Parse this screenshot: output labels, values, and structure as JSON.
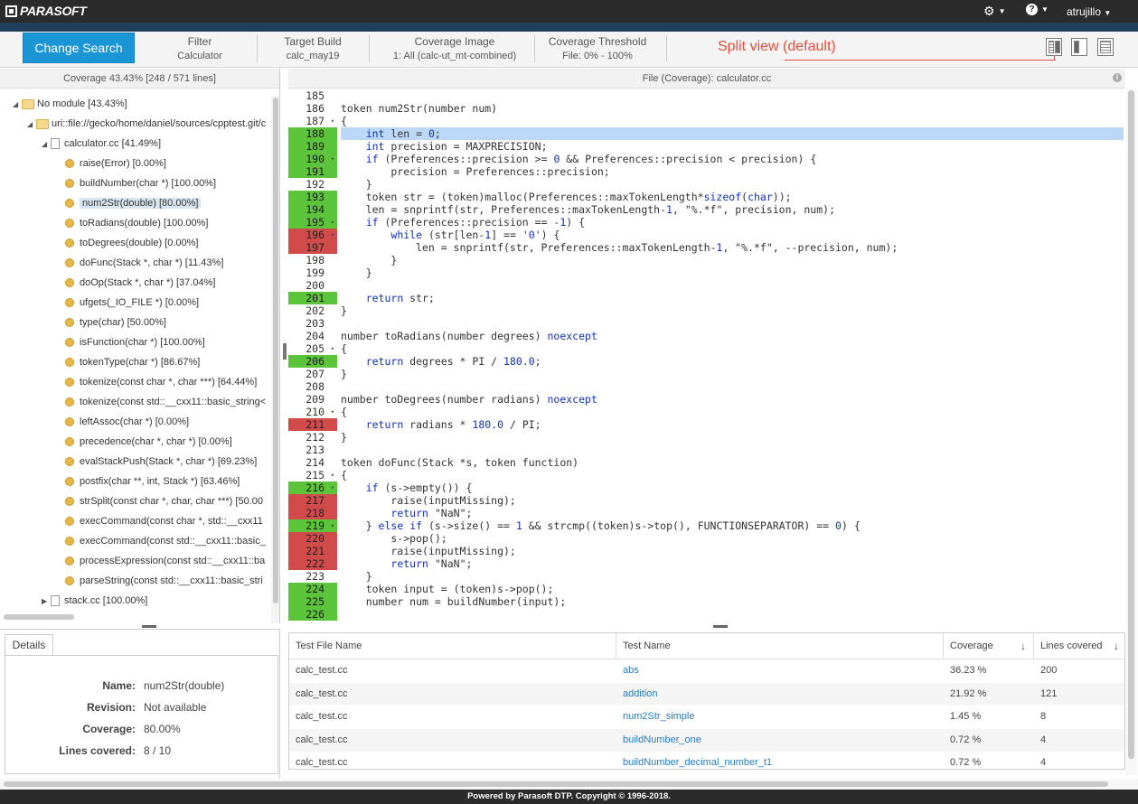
{
  "brand": "PARASOFT",
  "user": "atrujillo",
  "toolbar": {
    "change_search": "Change Search",
    "groups": [
      {
        "label": "Filter",
        "value": "Calculator"
      },
      {
        "label": "Target Build",
        "value": "calc_may19"
      },
      {
        "label": "Coverage Image",
        "value": "1: All (calc-ut_mt-combined)"
      },
      {
        "label": "Coverage Threshold",
        "value": "File: 0% - 100%"
      }
    ],
    "split_note": "Split view (default)"
  },
  "left_header": "Coverage 43.43% [248 / 571 lines]",
  "tree": [
    {
      "label": "No module [43.43%]",
      "kind": "folder",
      "depth": 0,
      "expanded": true
    },
    {
      "label": "uri::file://gecko/home/daniel/sources/cpptest.git/c",
      "kind": "folder",
      "depth": 1,
      "expanded": true
    },
    {
      "label": "calculator.cc [41.49%]",
      "kind": "file",
      "depth": 2,
      "expanded": true
    },
    {
      "label": "raise(Error) [0.00%]",
      "kind": "func",
      "depth": 3
    },
    {
      "label": "buildNumber(char *) [100.00%]",
      "kind": "func",
      "depth": 3
    },
    {
      "label": "num2Str(double) [80.00%]",
      "kind": "func",
      "depth": 3,
      "selected": true
    },
    {
      "label": "toRadians(double) [100.00%]",
      "kind": "func",
      "depth": 3
    },
    {
      "label": "toDegrees(double) [0.00%]",
      "kind": "func",
      "depth": 3
    },
    {
      "label": "doFunc(Stack *, char *) [11.43%]",
      "kind": "func",
      "depth": 3
    },
    {
      "label": "doOp(Stack *, char *) [37.04%]",
      "kind": "func",
      "depth": 3
    },
    {
      "label": "ufgets(_IO_FILE *) [0.00%]",
      "kind": "func",
      "depth": 3
    },
    {
      "label": "type(char) [50.00%]",
      "kind": "func",
      "depth": 3
    },
    {
      "label": "isFunction(char *) [100.00%]",
      "kind": "func",
      "depth": 3
    },
    {
      "label": "tokenType(char *) [86.67%]",
      "kind": "func",
      "depth": 3
    },
    {
      "label": "tokenize(const char *, char ***) [64.44%]",
      "kind": "func",
      "depth": 3
    },
    {
      "label": "tokenize(const std::__cxx11::basic_string<",
      "kind": "func",
      "depth": 3
    },
    {
      "label": "leftAssoc(char *) [0.00%]",
      "kind": "func",
      "depth": 3
    },
    {
      "label": "precedence(char *, char *) [0.00%]",
      "kind": "func",
      "depth": 3
    },
    {
      "label": "evalStackPush(Stack *, char *) [69.23%]",
      "kind": "func",
      "depth": 3
    },
    {
      "label": "postfix(char **, int, Stack *) [63.46%]",
      "kind": "func",
      "depth": 3
    },
    {
      "label": "strSplit(const char *, char, char ***) [50.00",
      "kind": "func",
      "depth": 3
    },
    {
      "label": "execCommand(const char *, std::__cxx11",
      "kind": "func",
      "depth": 3
    },
    {
      "label": "execCommand(const std::__cxx11::basic_",
      "kind": "func",
      "depth": 3
    },
    {
      "label": "processExpression(const std::__cxx11::ba",
      "kind": "func",
      "depth": 3
    },
    {
      "label": "parseString(const std::__cxx11::basic_stri",
      "kind": "func",
      "depth": 3
    },
    {
      "label": "stack.cc [100.00%]",
      "kind": "file",
      "depth": 2,
      "expanded": false
    }
  ],
  "details": {
    "tab": "Details",
    "rows": [
      {
        "label": "Name:",
        "value": "num2Str(double)"
      },
      {
        "label": "Revision:",
        "value": "Not available"
      },
      {
        "label": "Coverage:",
        "value": "80.00%"
      },
      {
        "label": "Lines covered:",
        "value": "8 / 10"
      }
    ]
  },
  "code_header": "File (Coverage): calculator.cc",
  "code": [
    {
      "n": "185",
      "s": "",
      "t": ""
    },
    {
      "n": "186",
      "s": "",
      "t": "token num2Str(number num)"
    },
    {
      "n": "187",
      "s": "",
      "f": true,
      "t": "{"
    },
    {
      "n": "188",
      "s": "c",
      "hl": true,
      "t": "    int len = 0;"
    },
    {
      "n": "189",
      "s": "c",
      "t": "    int precision = MAXPRECISION;"
    },
    {
      "n": "190",
      "s": "c",
      "f": true,
      "t": "    if (Preferences::precision >= 0 && Preferences::precision < precision) {"
    },
    {
      "n": "191",
      "s": "c",
      "t": "        precision = Preferences::precision;"
    },
    {
      "n": "192",
      "s": "",
      "t": "    }"
    },
    {
      "n": "193",
      "s": "c",
      "t": "    token str = (token)malloc(Preferences::maxTokenLength*sizeof(char));"
    },
    {
      "n": "194",
      "s": "c",
      "t": "    len = snprintf(str, Preferences::maxTokenLength-1, \"%.*f\", precision, num);"
    },
    {
      "n": "195",
      "s": "c",
      "f": true,
      "t": "    if (Preferences::precision == -1) {"
    },
    {
      "n": "196",
      "s": "u",
      "f": true,
      "t": "        while (str[len-1] == '0') {"
    },
    {
      "n": "197",
      "s": "u",
      "t": "            len = snprintf(str, Preferences::maxTokenLength-1, \"%.*f\", --precision, num);"
    },
    {
      "n": "198",
      "s": "",
      "t": "        }"
    },
    {
      "n": "199",
      "s": "",
      "t": "    }"
    },
    {
      "n": "200",
      "s": "",
      "t": ""
    },
    {
      "n": "201",
      "s": "c",
      "t": "    return str;"
    },
    {
      "n": "202",
      "s": "",
      "t": "}"
    },
    {
      "n": "203",
      "s": "",
      "t": ""
    },
    {
      "n": "204",
      "s": "",
      "t": "number toRadians(number degrees) noexcept"
    },
    {
      "n": "205",
      "s": "",
      "f": true,
      "t": "{"
    },
    {
      "n": "206",
      "s": "c",
      "t": "    return degrees * PI / 180.0;"
    },
    {
      "n": "207",
      "s": "",
      "t": "}"
    },
    {
      "n": "208",
      "s": "",
      "t": ""
    },
    {
      "n": "209",
      "s": "",
      "t": "number toDegrees(number radians) noexcept"
    },
    {
      "n": "210",
      "s": "",
      "f": true,
      "t": "{"
    },
    {
      "n": "211",
      "s": "u",
      "t": "    return radians * 180.0 / PI;"
    },
    {
      "n": "212",
      "s": "",
      "t": "}"
    },
    {
      "n": "213",
      "s": "",
      "t": ""
    },
    {
      "n": "214",
      "s": "",
      "t": "token doFunc(Stack *s, token function)"
    },
    {
      "n": "215",
      "s": "",
      "f": true,
      "t": "{"
    },
    {
      "n": "216",
      "s": "c",
      "f": true,
      "t": "    if (s->empty()) {"
    },
    {
      "n": "217",
      "s": "u",
      "t": "        raise(inputMissing);"
    },
    {
      "n": "218",
      "s": "u",
      "t": "        return \"NaN\";"
    },
    {
      "n": "219",
      "s": "c",
      "f": true,
      "t": "    } else if (s->size() == 1 && strcmp((token)s->top(), FUNCTIONSEPARATOR) == 0) {"
    },
    {
      "n": "220",
      "s": "u",
      "t": "        s->pop();"
    },
    {
      "n": "221",
      "s": "u",
      "t": "        raise(inputMissing);"
    },
    {
      "n": "222",
      "s": "u",
      "t": "        return \"NaN\";"
    },
    {
      "n": "223",
      "s": "",
      "t": "    }"
    },
    {
      "n": "224",
      "s": "c",
      "t": "    token input = (token)s->pop();"
    },
    {
      "n": "225",
      "s": "c",
      "t": "    number num = buildNumber(input);"
    },
    {
      "n": "226",
      "s": "c",
      "t": ""
    }
  ],
  "table": {
    "headers": [
      "Test File Name",
      "Test Name",
      "Coverage",
      "Lines covered"
    ],
    "rows": [
      [
        "calc_test.cc",
        "abs",
        "36.23 %",
        "200"
      ],
      [
        "calc_test.cc",
        "addition",
        "21.92 %",
        "121"
      ],
      [
        "calc_test.cc",
        "num2Str_simple",
        "1.45 %",
        "8"
      ],
      [
        "calc_test.cc",
        "buildNumber_one",
        "0.72 %",
        "4"
      ],
      [
        "calc_test.cc",
        "buildNumber_decimal_number_t1",
        "0.72 %",
        "4"
      ]
    ]
  },
  "footer": "Powered by Parasoft DTP. Copyright © 1996-2018."
}
